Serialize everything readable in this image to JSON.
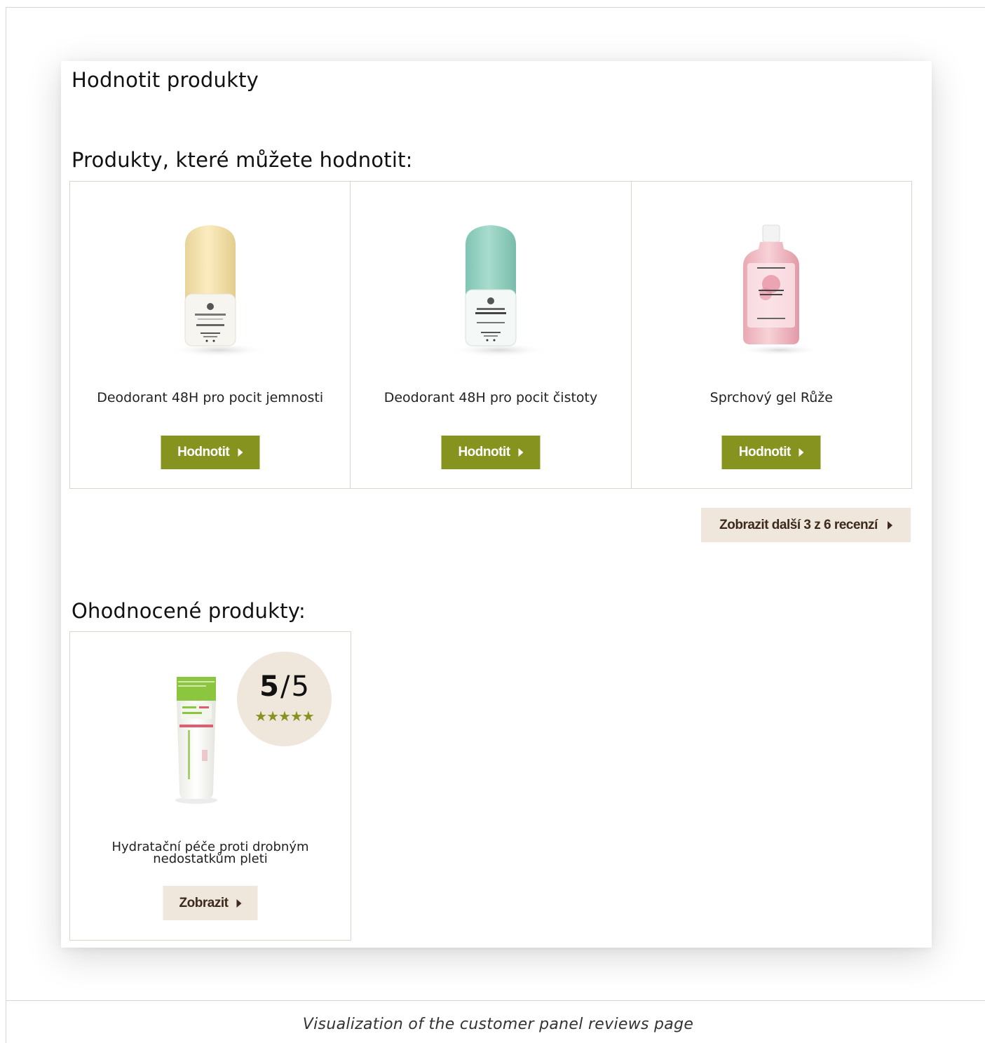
{
  "panel": {
    "title": "Hodnotit produkty",
    "to_review_heading": "Produkty, které můžete hodnotit:",
    "reviewed_heading": "Ohodnocené produkty:"
  },
  "products_to_review": [
    {
      "name": "Deodorant 48H pro pocit jemnosti",
      "button": "Hodnotit",
      "image": "yellow-deodorant-roll-on"
    },
    {
      "name": "Deodorant 48H pro pocit čistoty",
      "button": "Hodnotit",
      "image": "teal-deodorant-roll-on"
    },
    {
      "name": "Sprchový gel Růže",
      "button": "Hodnotit",
      "image": "pink-shower-gel-bottle"
    }
  ],
  "more_button": "Zobrazit další 3 z 6 recenzí",
  "reviewed_products": [
    {
      "name": "Hydratační péče proti drobným nedostatkům pleti",
      "score": "5",
      "score_max": "5",
      "stars": "★★★★★",
      "rating": 5,
      "button": "Zobrazit",
      "image": "green-cream-tube"
    }
  ],
  "caption": "Visualization of the customer panel reviews page",
  "colors": {
    "accent": "#86941f",
    "secondary_button": "#efe6dc",
    "secondary_text": "#3d2a1c",
    "border": "#d9d6cc"
  }
}
